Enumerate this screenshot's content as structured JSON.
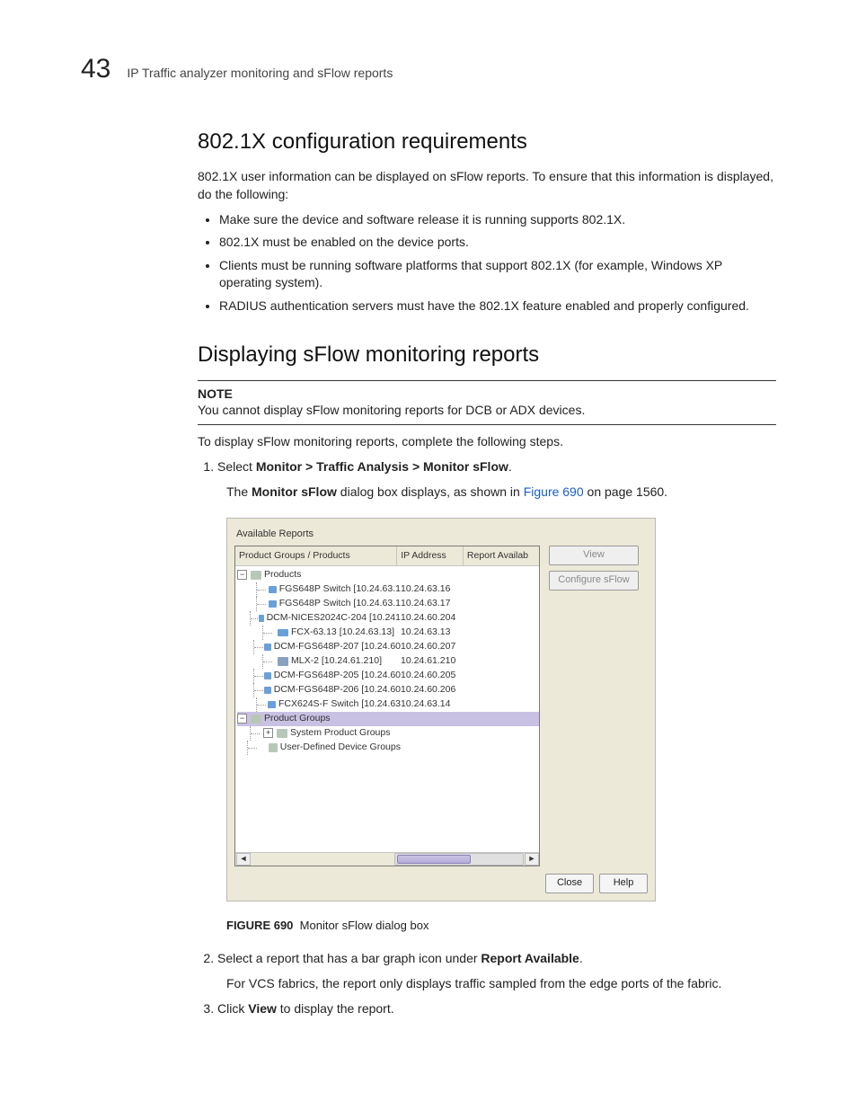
{
  "page_number": "43",
  "page_title": "IP Traffic analyzer monitoring and sFlow reports",
  "section1_heading": "802.1X configuration requirements",
  "section1_intro": "802.1X user information can be displayed on sFlow reports. To ensure that this information is displayed, do the following:",
  "bullets": [
    "Make sure the device and software release it is running supports 802.1X.",
    "802.1X must be enabled on the device ports.",
    "Clients must be running software platforms that support 802.1X (for example, Windows XP operating system).",
    "RADIUS authentication servers must have the 802.1X feature enabled and properly configured."
  ],
  "section2_heading": "Displaying sFlow monitoring reports",
  "note_label": "NOTE",
  "note_body": "You cannot display sFlow monitoring reports for DCB or ADX devices.",
  "section2_intro": "To display sFlow monitoring reports, complete the following steps.",
  "step1_prefix": "Select ",
  "step1_bold": "Monitor > Traffic Analysis > Monitor sFlow",
  "step1_suffix": ".",
  "step1_body_prefix": "The ",
  "step1_body_bold": "Monitor sFlow",
  "step1_body_mid": " dialog box displays, as shown in ",
  "step1_body_link": "Figure 690",
  "step1_body_suffix": " on page 1560.",
  "dialog": {
    "group_label": "Available Reports",
    "columns": {
      "c1": "Product Groups / Products",
      "c2": "IP Address",
      "c3": "Report Availab"
    },
    "root_products": "Products",
    "products": [
      {
        "name": "FGS648P Switch [10.24.63.1",
        "ip": "10.24.63.16"
      },
      {
        "name": "FGS648P Switch [10.24.63.1",
        "ip": "10.24.63.17"
      },
      {
        "name": "DCM-NICES2024C-204 [10.241",
        "ip": "10.24.60.204"
      },
      {
        "name": "FCX-63.13 [10.24.63.13]",
        "ip": "10.24.63.13"
      },
      {
        "name": "DCM-FGS648P-207 [10.24.60",
        "ip": "10.24.60.207"
      },
      {
        "name": "MLX-2 [10.24.61.210]",
        "ip": "10.24.61.210",
        "router": true
      },
      {
        "name": "DCM-FGS648P-205 [10.24.60",
        "ip": "10.24.60.205"
      },
      {
        "name": "DCM-FGS648P-206 [10.24.60",
        "ip": "10.24.60.206"
      },
      {
        "name": "FCX624S-F Switch [10.24.63",
        "ip": "10.24.63.14"
      }
    ],
    "root_groups": "Product Groups",
    "group_children": [
      {
        "name": "System Product Groups",
        "expandable": true
      },
      {
        "name": "User-Defined Device Groups",
        "expandable": false
      }
    ],
    "buttons": {
      "view": "View",
      "configure": "Configure sFlow",
      "close": "Close",
      "help": "Help"
    }
  },
  "figure_label": "FIGURE 690",
  "figure_caption": "Monitor sFlow dialog box",
  "step2_prefix": "Select a report that has a bar graph icon under ",
  "step2_bold": "Report Available",
  "step2_suffix": ".",
  "step2_body": "For VCS fabrics, the report only displays traffic sampled from the edge ports of the fabric.",
  "step3_prefix": "Click ",
  "step3_bold": "View",
  "step3_suffix": " to display the report."
}
